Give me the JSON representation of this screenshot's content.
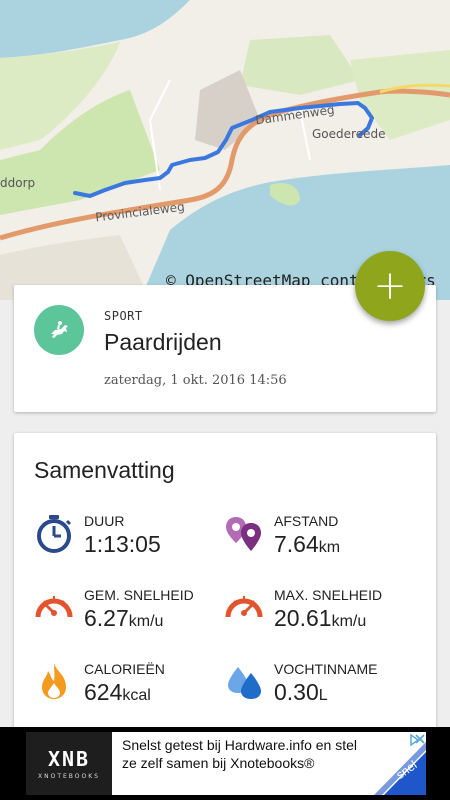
{
  "map": {
    "attribution": "© OpenStreetMap contributors",
    "labels": {
      "road_provincialeweg": "Provincialeweg",
      "road_dammenweg": "Dammenweg",
      "town_goedereede": "Goedereede",
      "town_ouddorp": "ddorp"
    },
    "colors": {
      "land": "#f2efe9",
      "water": "#aad3df",
      "route": "#3a78e0",
      "road": "#e39a6b",
      "green": "#cde6b0"
    }
  },
  "fab": {
    "icon": "plus-icon",
    "label": "+"
  },
  "sport": {
    "caption": "SPORT",
    "name": "Paardrijden",
    "date": "zaterdag, 1 okt. 2016 14:56",
    "icon": "horse-riding-icon",
    "icon_color": "#5cc59a"
  },
  "summary": {
    "title": "Samenvatting",
    "stats": [
      {
        "label": "DUUR",
        "value": "1:13:05",
        "unit": "",
        "icon": "stopwatch-icon"
      },
      {
        "label": "AFSTAND",
        "value": "7.64",
        "unit": "km",
        "icon": "map-pins-icon"
      },
      {
        "label": "GEM. SNELHEID",
        "value": "6.27",
        "unit": "km/u",
        "icon": "speedometer-icon"
      },
      {
        "label": "MAX. SNELHEID",
        "value": "20.61",
        "unit": "km/u",
        "icon": "speedometer-max-icon"
      },
      {
        "label": "CALORIEËN",
        "value": "624",
        "unit": "kcal",
        "icon": "flame-icon"
      },
      {
        "label": "VOCHTINNAME",
        "value": "0.30",
        "unit": "L",
        "icon": "water-drops-icon"
      }
    ]
  },
  "ad": {
    "logo": "XNB",
    "logo_sub": "XNOTEBOOKS",
    "text": "Snelst getest bij Hardware.info en stel ze zelf samen bij Xnotebooks®",
    "badge": "Bestel snel"
  }
}
